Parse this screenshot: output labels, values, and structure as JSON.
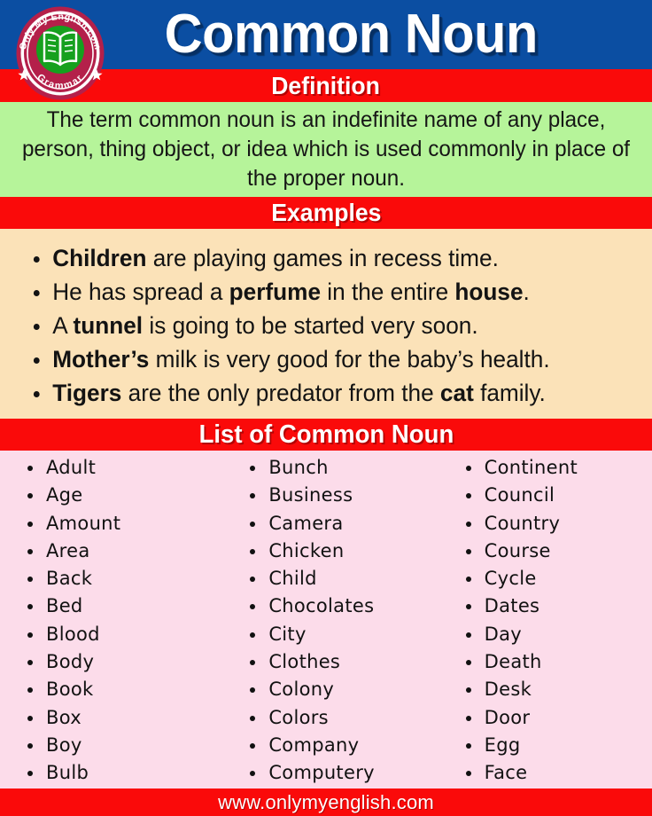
{
  "colors": {
    "header_blue": "#0b4ea2",
    "bar_red": "#fa0a0a",
    "definition_green": "#b6f49a",
    "examples_peach": "#fbe2b8",
    "list_pink": "#fcdcea",
    "badge_maroon": "#b4204a",
    "badge_green": "#16a01e",
    "text_dark": "#131313"
  },
  "logo": {
    "top_text": "Only My English.com",
    "bottom_text": "Grammar",
    "icon": "open-book-icon"
  },
  "header": {
    "title": "Common Noun"
  },
  "definition": {
    "heading": "Definition",
    "body": "The term common noun is an indefinite name of any place, person, thing object, or idea which is used commonly in place of the proper noun."
  },
  "examples": {
    "heading": "Examples",
    "items": [
      {
        "parts": [
          {
            "text": "Children",
            "bold": true
          },
          {
            "text": " are playing games in recess time.",
            "bold": false
          }
        ]
      },
      {
        "parts": [
          {
            "text": "He has spread a ",
            "bold": false
          },
          {
            "text": "perfume",
            "bold": true
          },
          {
            "text": " in the entire ",
            "bold": false
          },
          {
            "text": "house",
            "bold": true
          },
          {
            "text": ".",
            "bold": false
          }
        ]
      },
      {
        "parts": [
          {
            "text": "A ",
            "bold": false
          },
          {
            "text": "tunnel",
            "bold": true
          },
          {
            "text": " is going to be started very soon.",
            "bold": false
          }
        ]
      },
      {
        "parts": [
          {
            "text": "Mother’s",
            "bold": true
          },
          {
            "text": " milk is very good for the baby’s health.",
            "bold": false
          }
        ]
      },
      {
        "parts": [
          {
            "text": "Tigers",
            "bold": true
          },
          {
            "text": " are the only predator from the ",
            "bold": false
          },
          {
            "text": "cat",
            "bold": true
          },
          {
            "text": " family.",
            "bold": false
          }
        ]
      }
    ]
  },
  "word_list": {
    "heading": "List of Common Noun",
    "columns": [
      [
        "Adult",
        "Age",
        "Amount",
        "Area",
        "Back",
        "Bed",
        "Blood",
        "Body",
        "Book",
        "Box",
        "Boy",
        "Bulb"
      ],
      [
        "Bunch",
        "Business",
        "Camera",
        "Chicken",
        "Child",
        "Chocolates",
        "City",
        "Clothes",
        "Colony",
        "Colors",
        "Company",
        "Computery"
      ],
      [
        "Continent",
        "Council",
        "Country",
        "Course",
        "Cycle",
        "Dates",
        "Day",
        "Death",
        "Desk",
        "Door",
        "Egg",
        "Face"
      ]
    ]
  },
  "footer": {
    "url": "www.onlymyenglish.com"
  }
}
